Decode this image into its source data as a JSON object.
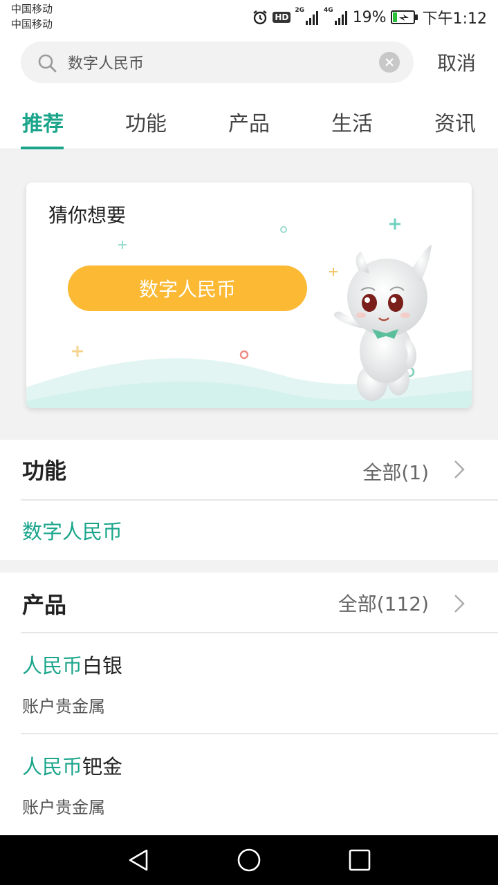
{
  "status_bar": {
    "carrier_1": "中国移动",
    "carrier_2": "中国移动",
    "hd": "HD",
    "net_1": "2G",
    "net_2": "4G",
    "battery": "19%",
    "time": "下午1:12",
    "icons": [
      "alarm-icon",
      "signal-icon",
      "battery-charging-icon"
    ]
  },
  "search": {
    "value": "数字人民币",
    "cancel_label": "取消",
    "icons": [
      "search-icon",
      "clear-icon"
    ]
  },
  "tabs": [
    {
      "label": "推荐",
      "active": true
    },
    {
      "label": "功能",
      "active": false
    },
    {
      "label": "产品",
      "active": false
    },
    {
      "label": "生活",
      "active": false
    },
    {
      "label": "资讯",
      "active": false
    }
  ],
  "suggest_card": {
    "title": "猜你想要",
    "pill_label": "数字人民币"
  },
  "feature_section": {
    "title": "功能",
    "all_label": "全部(1)",
    "items": [
      "数字人民币"
    ]
  },
  "product_section": {
    "title": "产品",
    "all_label": "全部(112)",
    "items": [
      {
        "highlight": "人民币",
        "rest": "白银",
        "subtitle": "账户贵金属"
      },
      {
        "highlight": "人民币",
        "rest": "钯金",
        "subtitle": "账户贵金属"
      }
    ]
  },
  "colors": {
    "accent": "#1aa58b",
    "pill": "#fbb934",
    "text": "#222222",
    "background": "#f2f2f2"
  },
  "nav_bar": [
    "back-icon",
    "home-icon",
    "recents-icon"
  ]
}
